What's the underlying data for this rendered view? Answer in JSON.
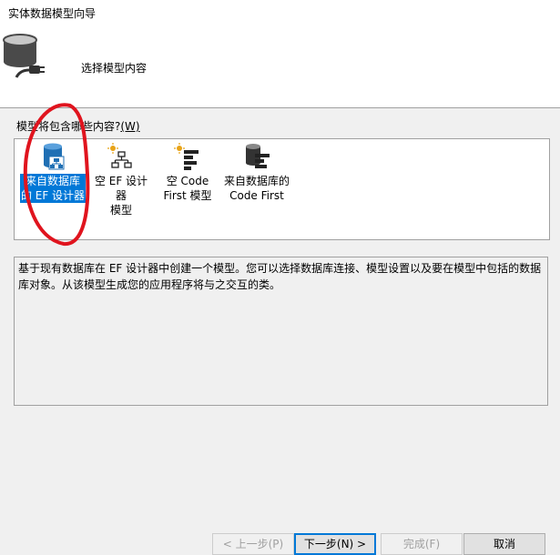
{
  "window": {
    "title": "实体数据模型向导"
  },
  "header": {
    "title": "选择模型内容"
  },
  "prompt": {
    "text": "模型将包含哪些内容?",
    "accesskey": "(W)"
  },
  "choices": [
    {
      "line1": "来自数据库",
      "line2": "的 EF 设计器",
      "selected": true,
      "icon": "database-designer-icon"
    },
    {
      "line1": "空 EF 设计器",
      "line2": "模型",
      "selected": false,
      "icon": "empty-designer-icon"
    },
    {
      "line1": "空 Code",
      "line2": "First 模型",
      "selected": false,
      "icon": "empty-code-first-icon"
    },
    {
      "line1": "来自数据库的",
      "line2": "Code First",
      "selected": false,
      "icon": "database-code-first-icon"
    }
  ],
  "description": "基于现有数据库在 EF 设计器中创建一个模型。您可以选择数据库连接、模型设置以及要在模型中包括的数据库对象。从该模型生成您的应用程序将与之交互的类。",
  "buttons": {
    "back": "< 上一步(P)",
    "next": "下一步(N) >",
    "finish": "完成(F)",
    "cancel": "取消"
  },
  "colors": {
    "selection": "#0078d7",
    "annotation": "#e0141e"
  }
}
